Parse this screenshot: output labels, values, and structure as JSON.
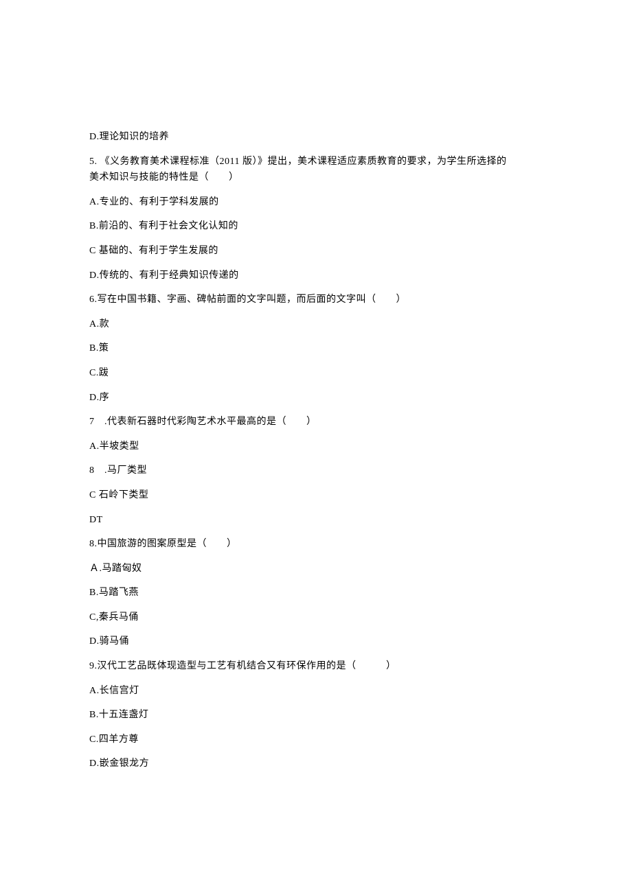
{
  "lines": {
    "l1": "D.理论知识的培养",
    "l2a": "5. 《义务教育美术课程标准（2011 版）》提出，美术课程适应素质教育的要求，为学生所选择的",
    "l2b": "美术知识与技能的特性是（　　）",
    "l3": "A.专业的、有利于学科发展的",
    "l4": "B.前沿的、有利于社会文化认知的",
    "l5": "C 基础的、有利于学生发展的",
    "l6": "D.传统的、有利于经典知识传递的",
    "l7": "6.写在中国书籍、字画、碑帖前面的文字叫题，而后面的文字叫（　　）",
    "l8": "A.款",
    "l9": "B.策",
    "l10": "C.跋",
    "l11": "D.序",
    "l12": "7　.代表新石器时代彩陶艺术水平最高的是（　　）",
    "l13": "A.半坡类型",
    "l14": "8　.马厂类型",
    "l15": "C 石岭下类型",
    "l16": "DT",
    "l17": "8.中国旅游的图案原型是（　　）",
    "l18": "Ａ.马踏匈奴",
    "l19": "B.马踏飞燕",
    "l20": "C,秦兵马俑",
    "l21": "D.骑马俑",
    "l22": "9.汉代工艺品既体现造型与工艺有机结合又有环保作用的是（　　　）",
    "l23": "A.长信宫灯",
    "l24": "B.十五连盏灯",
    "l25": "C.四羊方尊",
    "l26": "D.嵌金银龙方"
  }
}
